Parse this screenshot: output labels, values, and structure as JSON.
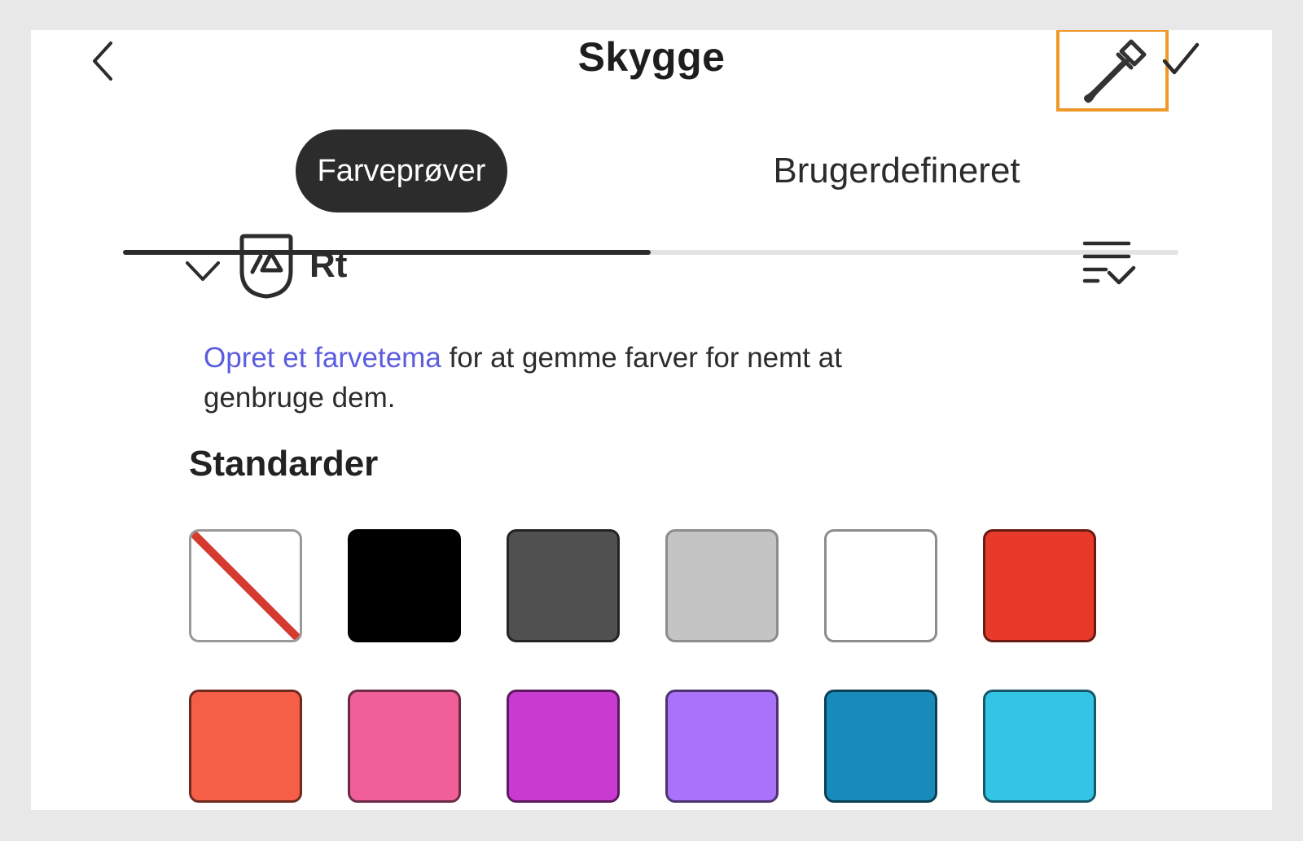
{
  "header": {
    "title": "Skygge",
    "back_icon": "chevron-left-icon",
    "eyedropper_icon": "eyedropper-icon",
    "confirm_icon": "checkmark-icon",
    "highlight_color": "#f0992b"
  },
  "tabs": [
    {
      "label": "Farveprøver",
      "selected": true
    },
    {
      "label": "Brugerdefineret",
      "selected": false
    }
  ],
  "library": {
    "expand_icon": "chevron-down-icon",
    "icon": "library-shield-icon",
    "name": "Rt",
    "sort_icon": "sort-filter-icon"
  },
  "info": {
    "link_text": "Opret et farvetema",
    "rest_text": " for at gemme farver for nemt at genbruge dem.",
    "link_color": "#5c5ce0"
  },
  "section": {
    "title": "Standarder"
  },
  "swatches": [
    {
      "name": "none",
      "color": "none"
    },
    {
      "name": "black",
      "color": "#000000"
    },
    {
      "name": "dark-gray",
      "color": "#505050"
    },
    {
      "name": "light-gray",
      "color": "#c4c4c4"
    },
    {
      "name": "white",
      "color": "#ffffff"
    },
    {
      "name": "red",
      "color": "#e83a2a"
    },
    {
      "name": "orange-red",
      "color": "#f55e47"
    },
    {
      "name": "pink",
      "color": "#f05f9a"
    },
    {
      "name": "magenta",
      "color": "#c93ad1"
    },
    {
      "name": "lavender",
      "color": "#a972f8"
    },
    {
      "name": "blue",
      "color": "#198bbb"
    },
    {
      "name": "cyan",
      "color": "#33c4e6"
    }
  ]
}
